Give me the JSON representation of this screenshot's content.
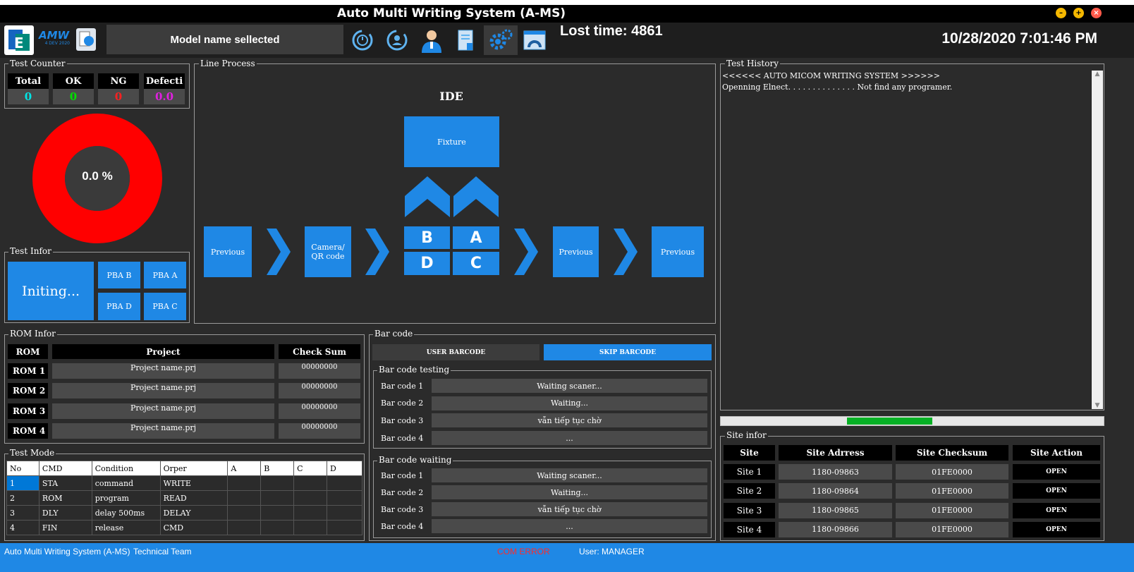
{
  "window": {
    "title": "Auto Multi Writing System (A-MS)"
  },
  "toolbar": {
    "logo_text": "AMW",
    "logo_sub": "4 DEV 2020",
    "model_name": "Model name sellected",
    "lost_time": "Lost time: 4861",
    "datetime": "10/28/2020 7:01:46 PM",
    "icons": [
      "refresh-clock-icon",
      "refresh-user-icon",
      "user-icon",
      "report-icon",
      "gear-icon",
      "browser-window-icon"
    ]
  },
  "test_counter": {
    "label": "Test Counter",
    "headers": [
      "Total",
      "OK",
      "NG",
      "Defecti"
    ],
    "values": [
      "0",
      "0",
      "0",
      "0.0"
    ],
    "colors": [
      "#00e5e5",
      "#00e000",
      "#ff2020",
      "#e020e0"
    ]
  },
  "donut": {
    "percent_text": "0.0 %",
    "color": "#ff0000"
  },
  "test_infor": {
    "label": "Test Infor",
    "status": "Initing...",
    "pba": [
      "PBA B",
      "PBA A",
      "PBA D",
      "PBA C"
    ]
  },
  "line_process": {
    "label": "Line Process",
    "title": "IDE",
    "fixture": "Fixture",
    "steps": [
      "Previous",
      "Camera/\nQR code",
      "Previous",
      "Previous"
    ],
    "sites": [
      "B",
      "A",
      "D",
      "C"
    ]
  },
  "test_history": {
    "label": "Test History",
    "lines": [
      "<<<<<< AUTO MICOM WRITING SYSTEM >>>>>>",
      "Openning Elnect. . . . . . . . . . . . . .  Not find any programer."
    ]
  },
  "rom_infor": {
    "label": "ROM Infor",
    "headers": [
      "ROM",
      "Project",
      "Check Sum"
    ],
    "rows": [
      [
        "ROM 1",
        "Project name.prj",
        "00000000"
      ],
      [
        "ROM 2",
        "Project name.prj",
        "00000000"
      ],
      [
        "ROM 3",
        "Project name.prj",
        "00000000"
      ],
      [
        "ROM 4",
        "Project name.prj",
        "00000000"
      ]
    ]
  },
  "barcode": {
    "label": "Bar code",
    "user_btn": "USER BARCODE",
    "skip_btn": "SKIP BARCODE",
    "testing": {
      "label": "Bar code testing",
      "rows": [
        [
          "Bar code 1",
          "Waiting scaner..."
        ],
        [
          "Bar code 2",
          "Waiting..."
        ],
        [
          "Bar code 3",
          "vẫn tiếp tục chờ"
        ],
        [
          "Bar code 4",
          "..."
        ]
      ]
    },
    "waiting": {
      "label": "Bar code waiting",
      "rows": [
        [
          "Bar code 1",
          "Waiting scaner..."
        ],
        [
          "Bar code 2",
          "Waiting..."
        ],
        [
          "Bar code 3",
          "vẫn tiếp tục chờ"
        ],
        [
          "Bar code 4",
          "..."
        ]
      ]
    }
  },
  "test_mode": {
    "label": "Test Mode",
    "headers": [
      "No",
      "CMD",
      "Condition",
      "Orper",
      "A",
      "B",
      "C",
      "D"
    ],
    "rows": [
      [
        "1",
        "STA",
        "command",
        "WRITE",
        "",
        "",
        "",
        ""
      ],
      [
        "2",
        "ROM",
        "program",
        "READ",
        "",
        "",
        "",
        ""
      ],
      [
        "3",
        "DLY",
        "delay 500ms",
        "DELAY",
        "",
        "",
        "",
        ""
      ],
      [
        "4",
        "FIN",
        "release",
        "CMD",
        "",
        "",
        "",
        ""
      ]
    ]
  },
  "progress": {
    "value": 0.3
  },
  "site_infor": {
    "label": "Site infor",
    "headers": [
      "Site",
      "Site Adrress",
      "Site Checksum",
      "Site Action"
    ],
    "rows": [
      [
        "Site 1",
        "1180-09863",
        "01FE0000",
        "OPEN"
      ],
      [
        "Site 2",
        "1180-09864",
        "01FE0000",
        "OPEN"
      ],
      [
        "Site 3",
        "1180-09865",
        "01FE0000",
        "OPEN"
      ],
      [
        "Site 4",
        "1180-09866",
        "01FE0000",
        "OPEN"
      ]
    ]
  },
  "status": {
    "app": "Auto Multi Writing System (A-MS)",
    "team": "Technical Team",
    "com": "COM ERROR",
    "user": "User: MANAGER"
  }
}
